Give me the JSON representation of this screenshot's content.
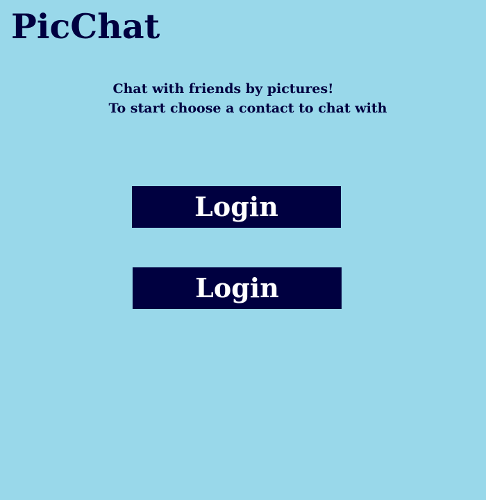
{
  "app": {
    "title": "PicChat"
  },
  "intro": {
    "line1": "Chat with friends by pictures!",
    "line2": "To start choose a contact to chat with"
  },
  "buttons": [
    {
      "label": "Login"
    },
    {
      "label": "Login"
    }
  ],
  "colors": {
    "background": "#99d8ea",
    "text": "#000040",
    "button_bg": "#000040",
    "button_text": "#ffffff"
  }
}
